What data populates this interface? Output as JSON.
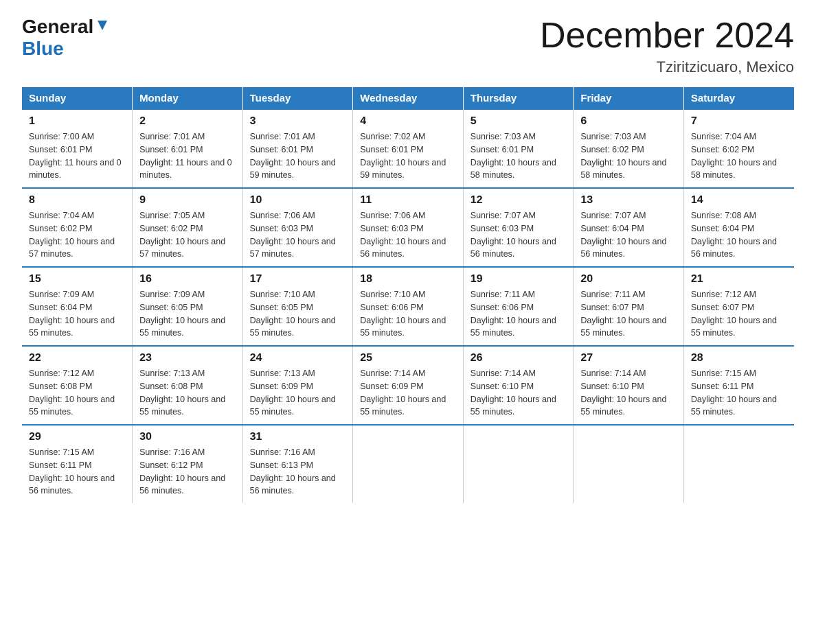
{
  "logo": {
    "line1": "General",
    "line2": "Blue"
  },
  "title": "December 2024",
  "subtitle": "Tziritzicuaro, Mexico",
  "days_header": [
    "Sunday",
    "Monday",
    "Tuesday",
    "Wednesday",
    "Thursday",
    "Friday",
    "Saturday"
  ],
  "weeks": [
    [
      {
        "num": "1",
        "sunrise": "7:00 AM",
        "sunset": "6:01 PM",
        "daylight": "11 hours and 0 minutes."
      },
      {
        "num": "2",
        "sunrise": "7:01 AM",
        "sunset": "6:01 PM",
        "daylight": "11 hours and 0 minutes."
      },
      {
        "num": "3",
        "sunrise": "7:01 AM",
        "sunset": "6:01 PM",
        "daylight": "10 hours and 59 minutes."
      },
      {
        "num": "4",
        "sunrise": "7:02 AM",
        "sunset": "6:01 PM",
        "daylight": "10 hours and 59 minutes."
      },
      {
        "num": "5",
        "sunrise": "7:03 AM",
        "sunset": "6:01 PM",
        "daylight": "10 hours and 58 minutes."
      },
      {
        "num": "6",
        "sunrise": "7:03 AM",
        "sunset": "6:02 PM",
        "daylight": "10 hours and 58 minutes."
      },
      {
        "num": "7",
        "sunrise": "7:04 AM",
        "sunset": "6:02 PM",
        "daylight": "10 hours and 58 minutes."
      }
    ],
    [
      {
        "num": "8",
        "sunrise": "7:04 AM",
        "sunset": "6:02 PM",
        "daylight": "10 hours and 57 minutes."
      },
      {
        "num": "9",
        "sunrise": "7:05 AM",
        "sunset": "6:02 PM",
        "daylight": "10 hours and 57 minutes."
      },
      {
        "num": "10",
        "sunrise": "7:06 AM",
        "sunset": "6:03 PM",
        "daylight": "10 hours and 57 minutes."
      },
      {
        "num": "11",
        "sunrise": "7:06 AM",
        "sunset": "6:03 PM",
        "daylight": "10 hours and 56 minutes."
      },
      {
        "num": "12",
        "sunrise": "7:07 AM",
        "sunset": "6:03 PM",
        "daylight": "10 hours and 56 minutes."
      },
      {
        "num": "13",
        "sunrise": "7:07 AM",
        "sunset": "6:04 PM",
        "daylight": "10 hours and 56 minutes."
      },
      {
        "num": "14",
        "sunrise": "7:08 AM",
        "sunset": "6:04 PM",
        "daylight": "10 hours and 56 minutes."
      }
    ],
    [
      {
        "num": "15",
        "sunrise": "7:09 AM",
        "sunset": "6:04 PM",
        "daylight": "10 hours and 55 minutes."
      },
      {
        "num": "16",
        "sunrise": "7:09 AM",
        "sunset": "6:05 PM",
        "daylight": "10 hours and 55 minutes."
      },
      {
        "num": "17",
        "sunrise": "7:10 AM",
        "sunset": "6:05 PM",
        "daylight": "10 hours and 55 minutes."
      },
      {
        "num": "18",
        "sunrise": "7:10 AM",
        "sunset": "6:06 PM",
        "daylight": "10 hours and 55 minutes."
      },
      {
        "num": "19",
        "sunrise": "7:11 AM",
        "sunset": "6:06 PM",
        "daylight": "10 hours and 55 minutes."
      },
      {
        "num": "20",
        "sunrise": "7:11 AM",
        "sunset": "6:07 PM",
        "daylight": "10 hours and 55 minutes."
      },
      {
        "num": "21",
        "sunrise": "7:12 AM",
        "sunset": "6:07 PM",
        "daylight": "10 hours and 55 minutes."
      }
    ],
    [
      {
        "num": "22",
        "sunrise": "7:12 AM",
        "sunset": "6:08 PM",
        "daylight": "10 hours and 55 minutes."
      },
      {
        "num": "23",
        "sunrise": "7:13 AM",
        "sunset": "6:08 PM",
        "daylight": "10 hours and 55 minutes."
      },
      {
        "num": "24",
        "sunrise": "7:13 AM",
        "sunset": "6:09 PM",
        "daylight": "10 hours and 55 minutes."
      },
      {
        "num": "25",
        "sunrise": "7:14 AM",
        "sunset": "6:09 PM",
        "daylight": "10 hours and 55 minutes."
      },
      {
        "num": "26",
        "sunrise": "7:14 AM",
        "sunset": "6:10 PM",
        "daylight": "10 hours and 55 minutes."
      },
      {
        "num": "27",
        "sunrise": "7:14 AM",
        "sunset": "6:10 PM",
        "daylight": "10 hours and 55 minutes."
      },
      {
        "num": "28",
        "sunrise": "7:15 AM",
        "sunset": "6:11 PM",
        "daylight": "10 hours and 55 minutes."
      }
    ],
    [
      {
        "num": "29",
        "sunrise": "7:15 AM",
        "sunset": "6:11 PM",
        "daylight": "10 hours and 56 minutes."
      },
      {
        "num": "30",
        "sunrise": "7:16 AM",
        "sunset": "6:12 PM",
        "daylight": "10 hours and 56 minutes."
      },
      {
        "num": "31",
        "sunrise": "7:16 AM",
        "sunset": "6:13 PM",
        "daylight": "10 hours and 56 minutes."
      },
      null,
      null,
      null,
      null
    ]
  ],
  "labels": {
    "sunrise": "Sunrise:",
    "sunset": "Sunset:",
    "daylight": "Daylight:"
  }
}
